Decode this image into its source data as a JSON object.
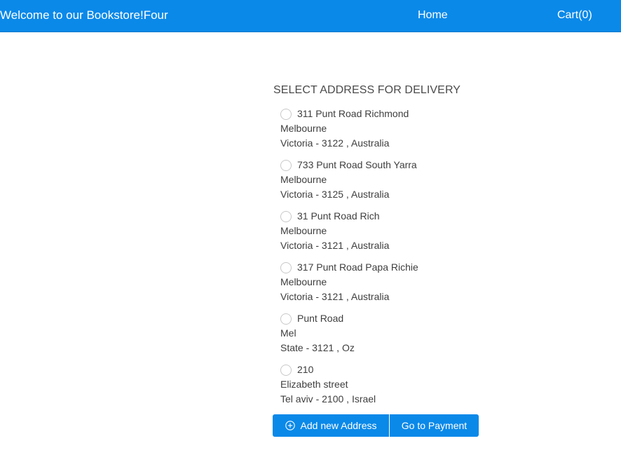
{
  "header": {
    "brand": "Welcome to our Bookstore!Four",
    "home_label": "Home",
    "cart_label": "Cart(0)"
  },
  "main": {
    "title": "SELECT ADDRESS FOR DELIVERY",
    "addresses": [
      {
        "line1": "311 Punt Road Richmond",
        "line2": "Melbourne",
        "line3": "Victoria - 3122 , Australia",
        "selected": false
      },
      {
        "line1": "733 Punt Road South Yarra",
        "line2": "Melbourne",
        "line3": "Victoria - 3125 , Australia",
        "selected": false
      },
      {
        "line1": "31 Punt Road Rich",
        "line2": "Melbourne",
        "line3": "Victoria - 3121 , Australia",
        "selected": false
      },
      {
        "line1": "317 Punt Road Papa Richie",
        "line2": "Melbourne",
        "line3": "Victoria - 3121 , Australia",
        "selected": false
      },
      {
        "line1": "Punt Road",
        "line2": "Mel",
        "line3": "State - 3121 , Oz",
        "selected": false
      },
      {
        "line1": "210",
        "line2": "Elizabeth street",
        "line3": "Tel aviv - 2100 , Israel",
        "selected": false
      }
    ],
    "add_address_label": "Add new Address",
    "add_address_icon": "plus-circle-icon",
    "payment_label": "Go to Payment"
  },
  "colors": {
    "primary": "#0a89e9",
    "text": "#3e3e3e"
  }
}
